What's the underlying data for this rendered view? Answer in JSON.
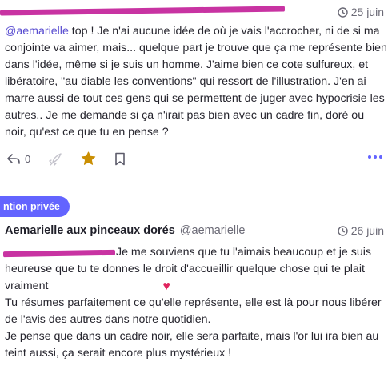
{
  "post1": {
    "time": "25 juin",
    "mention": "@aemarielle",
    "text": " top ! Je n'ai aucune idée de où je vais l'accrocher, ni de si ma conjointe va aimer, mais... quelque part je trouve que ça me représente bien dans l'idée, même si je suis un homme. J'aime bien ce cote sulfureux, et libératoire, \"au diable les conventions\" qui ressort de l'illustration. J'en ai marre aussi de tout ces gens qui se permettent de juger avec hypocrisie les autres.. Je me demande si ça n'irait pas bien avec un cadre fin, doré ou noir, qu'est ce que tu en pense ?",
    "reply_count": "0"
  },
  "post2": {
    "badge": "ntion privée",
    "author_name": "Aemarielle aux pinceaux dorés",
    "author_handle": "@aemarielle",
    "time": "26 juin",
    "para1": "Je me souviens que tu l'aimais beaucoup et je suis heureuse que tu te donnes le droit d'accueillir quelque chose qui te plait vraiment",
    "heart": "♥",
    "para2": "Tu résumes parfaitement ce qu'elle représente, elle est là pour nous libérer de l'avis des autres dans notre quotidien.",
    "para3": "Je pense que dans un cadre noir, elle sera parfaite, mais l'or lui ira bien au teint aussi, ça serait encore plus mystérieux !"
  },
  "colors": {
    "accent": "#6364ff",
    "star": "#ca8f04",
    "redaction": "#c4239b"
  }
}
